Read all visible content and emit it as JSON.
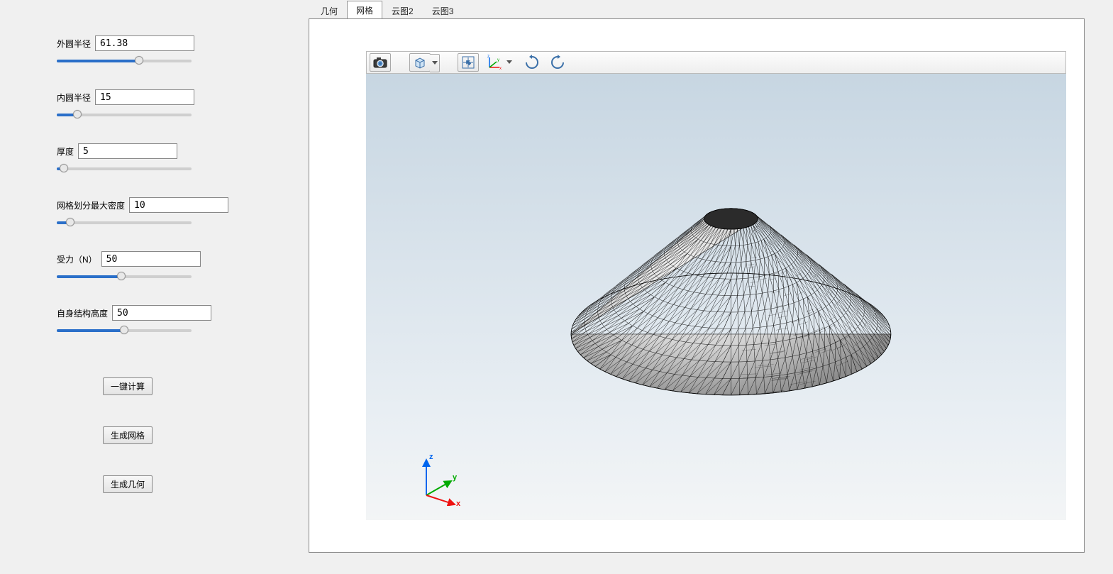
{
  "tabs": [
    {
      "label": "几何",
      "active": false
    },
    {
      "label": "网格",
      "active": true
    },
    {
      "label": "云图2",
      "active": false
    },
    {
      "label": "云图3",
      "active": false
    }
  ],
  "params": [
    {
      "label": "外圆半径",
      "value": "61.38",
      "pct": 61
    },
    {
      "label": "内圆半径",
      "value": "15",
      "pct": 15
    },
    {
      "label": "厚度",
      "value": "5",
      "pct": 5
    },
    {
      "label": "网格划分最大密度",
      "value": "10",
      "pct": 10
    },
    {
      "label": "受力（N）",
      "value": "50",
      "pct": 48
    },
    {
      "label": "自身结构高度",
      "value": "50",
      "pct": 50
    }
  ],
  "buttons": {
    "compute": "一键计算",
    "genMesh": "生成网格",
    "genGeom": "生成几何"
  },
  "toolbar": {
    "camera": "camera-icon",
    "projection": "cube-projection-icon",
    "fit": "fit-view-icon",
    "axes": "axes-triad-icon",
    "rotateCW": "rotate-cw-icon",
    "rotateCCW": "rotate-ccw-icon"
  },
  "axes": {
    "x": "x",
    "y": "y",
    "z": "z"
  },
  "colors": {
    "sliderFill": "#2a6fc9",
    "skyTop": "#c7d6e2",
    "skyBottom": "#f3f5f6",
    "xAxis": "#e11",
    "yAxis": "#0a0",
    "zAxis": "#06e"
  }
}
